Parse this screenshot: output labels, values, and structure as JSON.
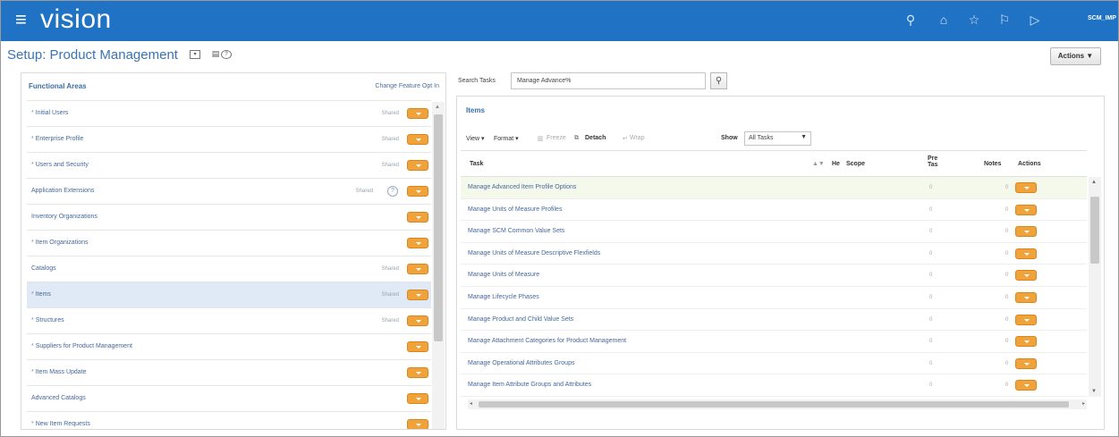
{
  "app": {
    "brand": "vision",
    "user": "SCM_IMP"
  },
  "page": {
    "title": "Setup: Product Management",
    "actions_label": "Actions ▼"
  },
  "functional_areas": {
    "header": "Functional Areas",
    "opt_in_link": "Change Feature Opt In",
    "items": [
      {
        "label": "Initial Users",
        "required": true,
        "shared": "Shared",
        "info": false
      },
      {
        "label": "Enterprise Profile",
        "required": true,
        "shared": "Shared",
        "info": false
      },
      {
        "label": "Users and Security",
        "required": true,
        "shared": "Shared",
        "info": false
      },
      {
        "label": "Application Extensions",
        "required": false,
        "shared": "Shared",
        "info": true
      },
      {
        "label": "Inventory Organizations",
        "required": false,
        "shared": "",
        "info": false
      },
      {
        "label": "Item Organizations",
        "required": true,
        "shared": "",
        "info": false
      },
      {
        "label": "Catalogs",
        "required": false,
        "shared": "Shared",
        "info": false
      },
      {
        "label": "Items",
        "required": true,
        "shared": "Shared",
        "info": false,
        "selected": true
      },
      {
        "label": "Structures",
        "required": true,
        "shared": "Shared",
        "info": false
      },
      {
        "label": "Suppliers for Product Management",
        "required": true,
        "shared": "",
        "info": false
      },
      {
        "label": "Item Mass Update",
        "required": true,
        "shared": "",
        "info": false
      },
      {
        "label": "Advanced Catalogs",
        "required": false,
        "shared": "",
        "info": false
      },
      {
        "label": "New Item Requests",
        "required": true,
        "shared": "",
        "info": false
      }
    ]
  },
  "search": {
    "label": "Search Tasks",
    "value": "Manage Advance%"
  },
  "items_panel": {
    "title": "Items",
    "toolbar": {
      "view": "View ▾",
      "format": "Format ▾",
      "freeze": "Freeze",
      "detach": "Detach",
      "wrap": "Wrap",
      "show_label": "Show",
      "show_value": "All Tasks"
    },
    "columns": {
      "task": "Task",
      "he": "He",
      "scope": "Scope",
      "pre": "Pre Tas",
      "notes": "Notes",
      "actions": "Actions"
    },
    "rows": [
      {
        "task": "Manage Advanced Item Profile Options",
        "pre": "0",
        "notes": "0",
        "selected": true
      },
      {
        "task": "Manage Units of Measure Profiles",
        "pre": "0",
        "notes": "0"
      },
      {
        "task": "Manage SCM Common Value Sets",
        "pre": "0",
        "notes": "0"
      },
      {
        "task": "Manage Units of Measure Descriptive Flexfields",
        "pre": "0",
        "notes": "0"
      },
      {
        "task": "Manage Units of Measure",
        "pre": "0",
        "notes": "0"
      },
      {
        "task": "Manage Lifecycle Phases",
        "pre": "0",
        "notes": "0"
      },
      {
        "task": "Manage Product and Child Value Sets",
        "pre": "0",
        "notes": "0"
      },
      {
        "task": "Manage Attachment Categories for Product Management",
        "pre": "0",
        "notes": "0"
      },
      {
        "task": "Manage Operational Attributes Groups",
        "pre": "0",
        "notes": "0"
      },
      {
        "task": "Manage Item Attribute Groups and Attributes",
        "pre": "0",
        "notes": "0"
      }
    ]
  }
}
